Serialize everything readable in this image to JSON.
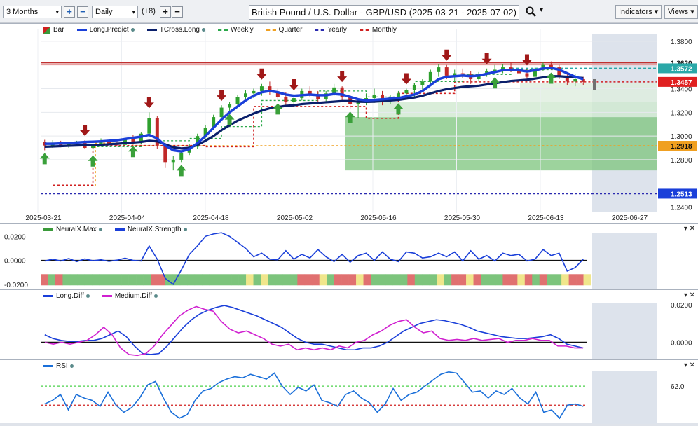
{
  "toolbar": {
    "range": "3 Months",
    "interval": "Daily",
    "offset": "(+8)",
    "title": "British Pound / U.S. Dollar - GBP/USD (2025-03-21 - 2025-07-02)",
    "indicators": "Indicators",
    "views": "Views",
    "plus": "+",
    "minus": "−",
    "search_icon": "search-icon",
    "caret": "▾"
  },
  "legend_main": [
    {
      "label": "Bar",
      "color": "#3a9a3a",
      "style": "swatch"
    },
    {
      "label": "Long.Predict",
      "color": "#1a3fd9",
      "style": "solid",
      "dot": true
    },
    {
      "label": "TCross.Long",
      "color": "#0a1f6b",
      "style": "solid",
      "dot": true
    },
    {
      "label": "Weekly",
      "color": "#2aa84a",
      "style": "dashed"
    },
    {
      "label": "Quarter",
      "color": "#f0a020",
      "style": "dashed"
    },
    {
      "label": "Yearly",
      "color": "#2a2ab0",
      "style": "dashed"
    },
    {
      "label": "Monthly",
      "color": "#d02020",
      "style": "dashed"
    }
  ],
  "legend_neural": [
    {
      "label": "NeuralX.Max",
      "color": "#3a9a3a",
      "dot": true
    },
    {
      "label": "NeuralX.Strength",
      "color": "#1a3fd9",
      "dot": true
    }
  ],
  "legend_diff": [
    {
      "label": "Long.Diff",
      "color": "#1a3fd9",
      "dot": true
    },
    {
      "label": "Medium.Diff",
      "color": "#d020d0",
      "dot": true
    }
  ],
  "legend_rsi": [
    {
      "label": "RSI",
      "color": "#1a6fd9",
      "dot": true
    }
  ],
  "panel_controls": "▾ ✕",
  "chart_data": [
    {
      "type": "candlestick",
      "panel": "price",
      "x_ticks": [
        "2025-03-21",
        "2025-04-04",
        "2025-04-18",
        "2025-05-02",
        "2025-05-16",
        "2025-05-30",
        "2025-06-13",
        "2025-06-27"
      ],
      "y_ticks": [
        "1.3800",
        "1.3400",
        "1.3200",
        "1.3000",
        "1.2800",
        "1.2400"
      ],
      "ylim": [
        1.235,
        1.39
      ],
      "price_labels": [
        {
          "value": "1.3620",
          "color": "#ffffff",
          "text_color": "#111"
        },
        {
          "value": "1.3572",
          "color": "#2aa8a8",
          "text_color": "#ffffff"
        },
        {
          "value": "1.3457",
          "color": "#e02020",
          "text_color": "#ffffff"
        },
        {
          "value": "1.2918",
          "color": "#f0a020",
          "text_color": "#111"
        },
        {
          "value": "1.2513",
          "color": "#1a3fd9",
          "text_color": "#ffffff"
        }
      ],
      "levels": {
        "monthly": 1.3457,
        "quarter": 1.2918,
        "yearly": 1.2513,
        "weekly": 1.3572,
        "top_band": 1.362
      },
      "ohlc": [
        [
          1.295,
          1.2968,
          1.288,
          1.292
        ],
        [
          1.292,
          1.2965,
          1.29,
          1.2945
        ],
        [
          1.2945,
          1.296,
          1.2905,
          1.2915
        ],
        [
          1.2915,
          1.294,
          1.29,
          1.2935
        ],
        [
          1.2935,
          1.296,
          1.292,
          1.2945
        ],
        [
          1.2945,
          1.2965,
          1.289,
          1.29
        ],
        [
          1.29,
          1.294,
          1.286,
          1.293
        ],
        [
          1.293,
          1.298,
          1.291,
          1.296
        ],
        [
          1.296,
          1.299,
          1.292,
          1.2935
        ],
        [
          1.2935,
          1.296,
          1.291,
          1.2925
        ],
        [
          1.2925,
          1.299,
          1.29,
          1.2975
        ],
        [
          1.2975,
          1.301,
          1.294,
          1.295
        ],
        [
          1.295,
          1.303,
          1.293,
          1.302
        ],
        [
          1.302,
          1.32,
          1.299,
          1.315
        ],
        [
          1.315,
          1.317,
          1.289,
          1.292
        ],
        [
          1.292,
          1.294,
          1.273,
          1.278
        ],
        [
          1.278,
          1.283,
          1.271,
          1.28
        ],
        [
          1.28,
          1.288,
          1.278,
          1.286
        ],
        [
          1.286,
          1.293,
          1.284,
          1.291
        ],
        [
          1.291,
          1.302,
          1.289,
          1.3
        ],
        [
          1.3,
          1.309,
          1.298,
          1.307
        ],
        [
          1.307,
          1.318,
          1.305,
          1.316
        ],
        [
          1.316,
          1.326,
          1.314,
          1.324
        ],
        [
          1.324,
          1.329,
          1.321,
          1.327
        ],
        [
          1.327,
          1.335,
          1.325,
          1.333
        ],
        [
          1.333,
          1.339,
          1.33,
          1.336
        ],
        [
          1.336,
          1.34,
          1.332,
          1.338
        ],
        [
          1.338,
          1.344,
          1.334,
          1.342
        ],
        [
          1.342,
          1.346,
          1.335,
          1.337
        ],
        [
          1.337,
          1.34,
          1.33,
          1.333
        ],
        [
          1.333,
          1.337,
          1.326,
          1.329
        ],
        [
          1.329,
          1.335,
          1.326,
          1.332
        ],
        [
          1.332,
          1.34,
          1.33,
          1.338
        ],
        [
          1.338,
          1.342,
          1.333,
          1.335
        ],
        [
          1.335,
          1.338,
          1.328,
          1.331
        ],
        [
          1.331,
          1.338,
          1.329,
          1.336
        ],
        [
          1.336,
          1.344,
          1.334,
          1.341
        ],
        [
          1.341,
          1.342,
          1.33,
          1.333
        ],
        [
          1.333,
          1.335,
          1.323,
          1.327
        ],
        [
          1.327,
          1.332,
          1.315,
          1.33
        ],
        [
          1.33,
          1.336,
          1.326,
          1.332
        ],
        [
          1.332,
          1.34,
          1.328,
          1.335
        ],
        [
          1.335,
          1.338,
          1.326,
          1.33
        ],
        [
          1.33,
          1.335,
          1.327,
          1.333
        ],
        [
          1.333,
          1.338,
          1.33,
          1.336
        ],
        [
          1.336,
          1.34,
          1.332,
          1.339
        ],
        [
          1.339,
          1.345,
          1.336,
          1.343
        ],
        [
          1.343,
          1.348,
          1.338,
          1.346
        ],
        [
          1.346,
          1.356,
          1.344,
          1.354
        ],
        [
          1.354,
          1.361,
          1.35,
          1.358
        ],
        [
          1.358,
          1.36,
          1.348,
          1.351
        ],
        [
          1.351,
          1.356,
          1.346,
          1.353
        ],
        [
          1.353,
          1.357,
          1.349,
          1.352
        ],
        [
          1.352,
          1.355,
          1.344,
          1.348
        ],
        [
          1.348,
          1.354,
          1.346,
          1.352
        ],
        [
          1.352,
          1.357,
          1.35,
          1.355
        ],
        [
          1.355,
          1.36,
          1.352,
          1.356
        ],
        [
          1.356,
          1.361,
          1.353,
          1.358
        ],
        [
          1.358,
          1.362,
          1.354,
          1.356
        ],
        [
          1.356,
          1.359,
          1.35,
          1.353
        ],
        [
          1.353,
          1.356,
          1.347,
          1.35
        ],
        [
          1.35,
          1.359,
          1.348,
          1.357
        ],
        [
          1.357,
          1.362,
          1.355,
          1.36
        ],
        [
          1.36,
          1.363,
          1.356,
          1.358
        ],
        [
          1.358,
          1.36,
          1.348,
          1.35
        ],
        [
          1.35,
          1.353,
          1.343,
          1.346
        ],
        [
          1.346,
          1.352,
          1.342,
          1.348
        ],
        [
          1.348,
          1.35,
          1.343,
          1.3457
        ]
      ],
      "long_predict": [
        1.2935,
        1.2935,
        1.2938,
        1.294,
        1.2945,
        1.295,
        1.2952,
        1.2955,
        1.296,
        1.2965,
        1.2975,
        1.2985,
        1.2995,
        1.301,
        1.298,
        1.292,
        1.288,
        1.287,
        1.289,
        1.294,
        1.3,
        1.307,
        1.314,
        1.32,
        1.325,
        1.33,
        1.334,
        1.337,
        1.338,
        1.337,
        1.335,
        1.334,
        1.3345,
        1.335,
        1.3345,
        1.3345,
        1.3355,
        1.335,
        1.333,
        1.331,
        1.33,
        1.3305,
        1.331,
        1.3315,
        1.332,
        1.3335,
        1.335,
        1.338,
        1.343,
        1.348,
        1.35,
        1.3505,
        1.351,
        1.3505,
        1.351,
        1.3525,
        1.354,
        1.3555,
        1.356,
        1.3555,
        1.3545,
        1.3555,
        1.357,
        1.3575,
        1.356,
        1.353,
        1.35,
        1.348
      ],
      "tcross_long": [
        1.291,
        1.2912,
        1.2915,
        1.2918,
        1.292,
        1.2922,
        1.2924,
        1.2926,
        1.293,
        1.2935,
        1.294,
        1.2945,
        1.295,
        1.296,
        1.2955,
        1.293,
        1.2905,
        1.2895,
        1.29,
        1.2925,
        1.296,
        1.3,
        1.305,
        1.309,
        1.313,
        1.316,
        1.319,
        1.3215,
        1.3235,
        1.3245,
        1.3255,
        1.326,
        1.327,
        1.3275,
        1.328,
        1.3285,
        1.329,
        1.3295,
        1.3295,
        1.329,
        1.3288,
        1.329,
        1.3295,
        1.33,
        1.3305,
        1.3315,
        1.3325,
        1.334,
        1.336,
        1.338,
        1.3395,
        1.3405,
        1.3415,
        1.342,
        1.3425,
        1.3435,
        1.3445,
        1.3455,
        1.3465,
        1.347,
        1.3475,
        1.3485,
        1.3495,
        1.3505,
        1.3505,
        1.35,
        1.3495,
        1.349
      ]
    },
    {
      "type": "line",
      "panel": "neural",
      "y_ticks": [
        "0.0200",
        "0.0000",
        "-0.0200"
      ],
      "ylim": [
        -0.023,
        0.026
      ],
      "series": [
        {
          "name": "NeuralX.Strength",
          "values": [
            -0.0005,
            0.001,
            -0.0005,
            0.0015,
            -0.001,
            0.0012,
            -0.0003,
            0.0005,
            -0.0008,
            0.0002,
            0.0018,
            0.0,
            -0.0005,
            0.012,
            0.001,
            -0.015,
            -0.02,
            -0.008,
            0.005,
            0.012,
            0.02,
            0.022,
            0.023,
            0.02,
            0.015,
            0.01,
            0.003,
            0.006,
            0.001,
            0.0005,
            0.008,
            0.001,
            0.005,
            0.002,
            0.009,
            0.003,
            -0.001,
            0.005,
            -0.0015,
            0.004,
            0.006,
            0.0,
            0.007,
            0.001,
            -0.001,
            0.007,
            0.006,
            0.002,
            0.003,
            0.006,
            0.003,
            0.007,
            -0.0005,
            0.008,
            0.001,
            0.004,
            -0.0005,
            0.006,
            0.004,
            0.005,
            -0.0005,
            0.001,
            0.009,
            0.004,
            0.006,
            -0.009,
            -0.006,
            0.001
          ]
        },
        {
          "name": "zero",
          "values": [
            0
          ]
        }
      ],
      "heat_blocks": [
        "red",
        "green",
        "red",
        "green",
        "green",
        "green",
        "green",
        "green",
        "green",
        "green",
        "green",
        "green",
        "green",
        "green",
        "green",
        "red",
        "red",
        "green",
        "green",
        "green",
        "green",
        "green",
        "green",
        "green",
        "green",
        "green",
        "green",
        "green",
        "yellow",
        "green",
        "yellow",
        "green",
        "green",
        "green",
        "green",
        "red",
        "red",
        "red",
        "yellow",
        "green",
        "red",
        "red",
        "red",
        "yellow",
        "red",
        "green",
        "green",
        "green",
        "green",
        "green",
        "red",
        "green",
        "green",
        "green",
        "yellow",
        "green",
        "red",
        "red",
        "yellow",
        "red",
        "green",
        "green",
        "green",
        "red",
        "red",
        "yellow",
        "red",
        "green",
        "red",
        "green",
        "green",
        "yellow",
        "red",
        "red",
        "yellow"
      ]
    },
    {
      "type": "line",
      "panel": "diff",
      "y_ticks": [
        "0.0200",
        "0.0000"
      ],
      "ylim": [
        -0.008,
        0.024
      ],
      "series": [
        {
          "name": "Long.Diff",
          "values": [
            0.004,
            0.002,
            0.001,
            0.0005,
            0.0005,
            0.001,
            0.001,
            0.002,
            0.004,
            0.006,
            0.003,
            -0.002,
            -0.006,
            -0.0065,
            -0.006,
            -0.002,
            0.003,
            0.008,
            0.012,
            0.015,
            0.017,
            0.0185,
            0.0195,
            0.0185,
            0.017,
            0.0155,
            0.014,
            0.012,
            0.01,
            0.008,
            0.005,
            0.002,
            0.0,
            -0.001,
            -0.001,
            -0.002,
            -0.003,
            -0.004,
            -0.004,
            -0.003,
            -0.003,
            -0.002,
            0.0,
            0.003,
            0.006,
            0.008,
            0.01,
            0.011,
            0.012,
            0.0115,
            0.0105,
            0.0095,
            0.008,
            0.006,
            0.005,
            0.004,
            0.003,
            0.0025,
            0.002,
            0.002,
            0.0025,
            0.003,
            0.004,
            0.002,
            -0.001,
            -0.002,
            -0.003
          ]
        },
        {
          "name": "Medium.Diff",
          "values": [
            0.0,
            -0.001,
            0.0,
            -0.001,
            0.0,
            0.001,
            0.004,
            0.008,
            0.004,
            -0.003,
            -0.0065,
            -0.007,
            -0.006,
            -0.002,
            0.004,
            0.009,
            0.014,
            0.017,
            0.019,
            0.0175,
            0.0165,
            0.011,
            0.007,
            0.005,
            0.006,
            0.004,
            0.002,
            -0.001,
            -0.002,
            -0.001,
            -0.004,
            -0.003,
            -0.004,
            -0.003,
            -0.004,
            -0.002,
            -0.003,
            0.0,
            0.001,
            0.004,
            0.006,
            0.009,
            0.011,
            0.012,
            0.008,
            0.005,
            0.006,
            0.002,
            0.001,
            0.0015,
            0.001,
            0.002,
            0.001,
            0.0015,
            0.002,
            0.0,
            0.001,
            0.001,
            0.002,
            0.001,
            0.001,
            -0.002,
            -0.002,
            -0.003,
            -0.003
          ]
        },
        {
          "name": "zero",
          "values": [
            0
          ]
        }
      ]
    },
    {
      "type": "line",
      "panel": "rsi",
      "y_ticks": [
        "62.0"
      ],
      "ylim": [
        32,
        78
      ],
      "levels": {
        "upper": 62,
        "lower": 46
      },
      "series": [
        {
          "name": "RSI",
          "values": [
            47,
            50,
            55,
            42,
            55,
            52,
            50,
            45,
            57,
            46,
            40,
            44,
            52,
            63,
            66,
            52,
            40,
            35,
            38,
            50,
            58,
            60,
            65,
            68,
            70,
            69,
            72,
            70,
            68,
            73,
            62,
            55,
            61,
            58,
            63,
            50,
            48,
            45,
            55,
            58,
            52,
            48,
            40,
            47,
            60,
            50,
            55,
            57,
            62,
            67,
            72,
            74,
            73,
            65,
            57,
            58,
            52,
            58,
            55,
            60,
            52,
            47,
            57,
            40,
            42,
            35,
            46,
            47,
            45
          ]
        }
      ]
    }
  ]
}
